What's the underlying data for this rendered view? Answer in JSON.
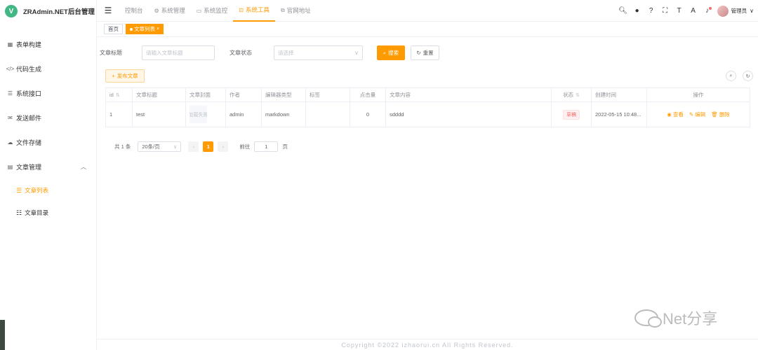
{
  "brand": {
    "logo_letter": "V",
    "title": "ZRAdmin.NET后台管理"
  },
  "sidebar": {
    "items": [
      {
        "label": "表单构建",
        "icon": "grid-icon"
      },
      {
        "label": "代码生成",
        "icon": "code-icon"
      },
      {
        "label": "系统接口",
        "icon": "list-icon"
      },
      {
        "label": "发送邮件",
        "icon": "mail-icon"
      },
      {
        "label": "文件存储",
        "icon": "cloud-icon"
      },
      {
        "label": "文章管理",
        "icon": "document-icon"
      }
    ],
    "submenu": [
      {
        "label": "文章列表",
        "active": true
      },
      {
        "label": "文章目录",
        "active": false
      }
    ]
  },
  "topnav": {
    "items": [
      {
        "label": "控制台"
      },
      {
        "label": "系统管理"
      },
      {
        "label": "系统监控"
      },
      {
        "label": "系统工具",
        "active": true
      },
      {
        "label": "官网地址"
      }
    ],
    "user_name": "管理员"
  },
  "tags": {
    "home": "首页",
    "active": "文章列表"
  },
  "filters": {
    "title_label": "文章标题",
    "title_placeholder": "请输入文章标题",
    "status_label": "文章状态",
    "status_placeholder": "请选择",
    "search_button": "搜索",
    "reset_button": "重置"
  },
  "toolbar": {
    "publish_button": "发布文章"
  },
  "table": {
    "headers": {
      "id": "id",
      "title": "文章标题",
      "cover": "文章封面",
      "author": "作者",
      "editor_type": "编辑器类型",
      "tags": "标签",
      "hits": "点击量",
      "content": "文章内容",
      "status": "状态",
      "created": "创建时间",
      "actions": "操作"
    },
    "rows": [
      {
        "id": "1",
        "title": "test",
        "cover": "加载失败",
        "author": "admin",
        "editor_type": "markdown",
        "tags": "",
        "hits": "0",
        "content": "sdddd",
        "status": "草稿",
        "created": "2022-05-15 10:48...",
        "view": "查看",
        "edit": "编辑",
        "delete": "删除"
      }
    ]
  },
  "pagination": {
    "total": "共 1 条",
    "page_size": "20条/页",
    "current": "1",
    "goto_label": "前往",
    "goto_value": "1",
    "page_suffix": "页"
  },
  "footer": {
    "copyright": "Copyright ©2022 izhaorui.cn All Rights Reserved."
  },
  "watermark": {
    "text": "Net分享"
  },
  "colors": {
    "accent": "#ff9a00",
    "danger": "#f56c6c",
    "logo": "#41b883"
  }
}
